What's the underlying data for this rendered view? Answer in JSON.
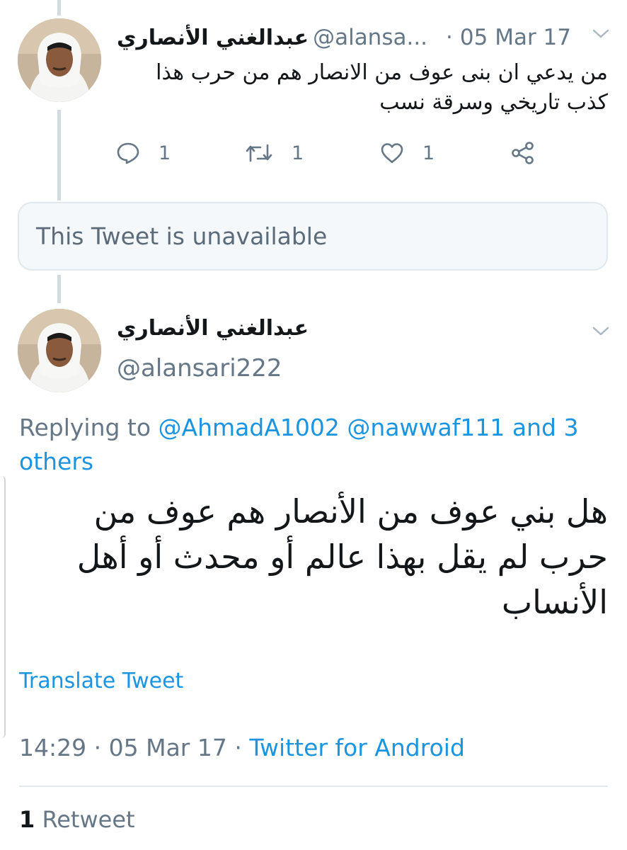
{
  "tweet1": {
    "display_name": "عبدالغني  الأنصاري",
    "handle": "@alansa...",
    "separator": "·",
    "date": "05 Mar 17",
    "text": "من يدعي  ان بنى عوف من الانصار هم من حرب  هذا كذب  تاريخي وسرقة نسب",
    "reply_count": "1",
    "retweet_count": "1",
    "like_count": "1"
  },
  "quoted": {
    "text": "This Tweet is unavailable"
  },
  "tweet2": {
    "display_name": "عبدالغني  الأنصاري",
    "handle": "@alansari222",
    "replying_prefix": "Replying to",
    "mention1": "@AhmadA1002",
    "mention2": "@nawwaf111",
    "others": "and 3 others",
    "text": "هل بني عوف من الأنصار هم عوف  من حرب لم يقل بهذا عالم أو محدث أو أهل الأنساب",
    "translate": "Translate Tweet",
    "time": "14:29",
    "separator": "·",
    "date": "05 Mar 17",
    "source": "Twitter for Android",
    "retweet_count": "1",
    "retweet_label": "Retweet"
  },
  "icons": {
    "reply": "reply-icon",
    "retweet": "retweet-icon",
    "like": "heart-icon",
    "share": "share-icon",
    "menu": "chevron-down-icon"
  },
  "colors": {
    "link": "#1b95e0",
    "secondary_text": "#657786",
    "thread_line": "#d2dbe1",
    "card_bg": "#f5f8fa"
  }
}
